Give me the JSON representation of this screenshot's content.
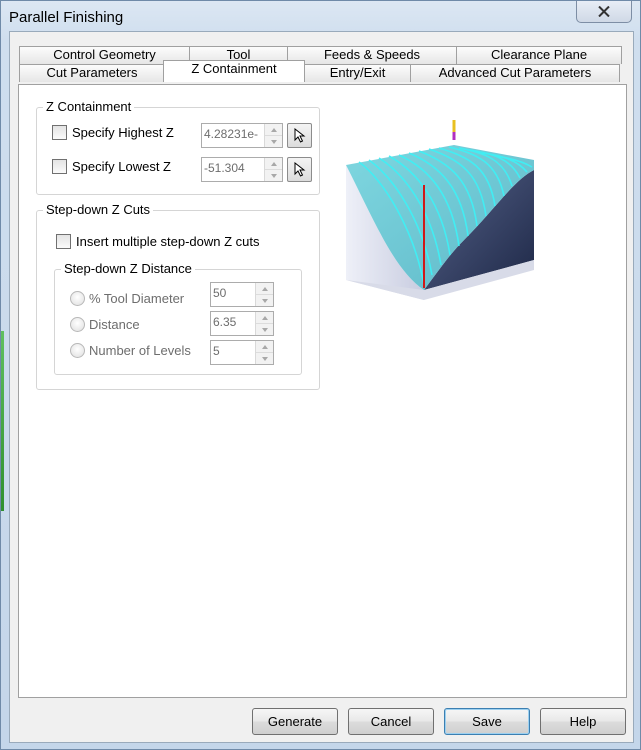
{
  "window": {
    "title": "Parallel Finishing"
  },
  "tabs": {
    "back_row": [
      "Control Geometry",
      "Tool",
      "Feeds & Speeds",
      "Clearance Plane"
    ],
    "front_row": [
      "Cut Parameters",
      "Z Containment",
      "Entry/Exit",
      "Advanced Cut Parameters"
    ],
    "active": "Z Containment"
  },
  "z_containment": {
    "title": "Z Containment",
    "highest": {
      "label": "Specify Highest Z",
      "checked": false,
      "value": "4.28231e-"
    },
    "lowest": {
      "label": "Specify Lowest Z",
      "checked": false,
      "value": "-51.304"
    }
  },
  "stepdown": {
    "title": "Step-down Z Cuts",
    "insert_label": "Insert multiple step-down Z cuts",
    "distance_group_title": "Step-down Z Distance",
    "options": [
      {
        "label": "% Tool Diameter",
        "value": "50"
      },
      {
        "label": "Distance",
        "value": "6.35"
      },
      {
        "label": "Number of Levels",
        "value": "5"
      }
    ]
  },
  "buttons": {
    "generate": "Generate",
    "cancel": "Cancel",
    "save": "Save",
    "help": "Help"
  },
  "colors": {
    "toolpath": "#39e0e8",
    "tool_line": "#d01818",
    "solid_side": "#3a4768",
    "panel": "#ffffff"
  },
  "icons": {
    "pick": "cursor-arrow-icon",
    "close": "close-x-icon"
  }
}
